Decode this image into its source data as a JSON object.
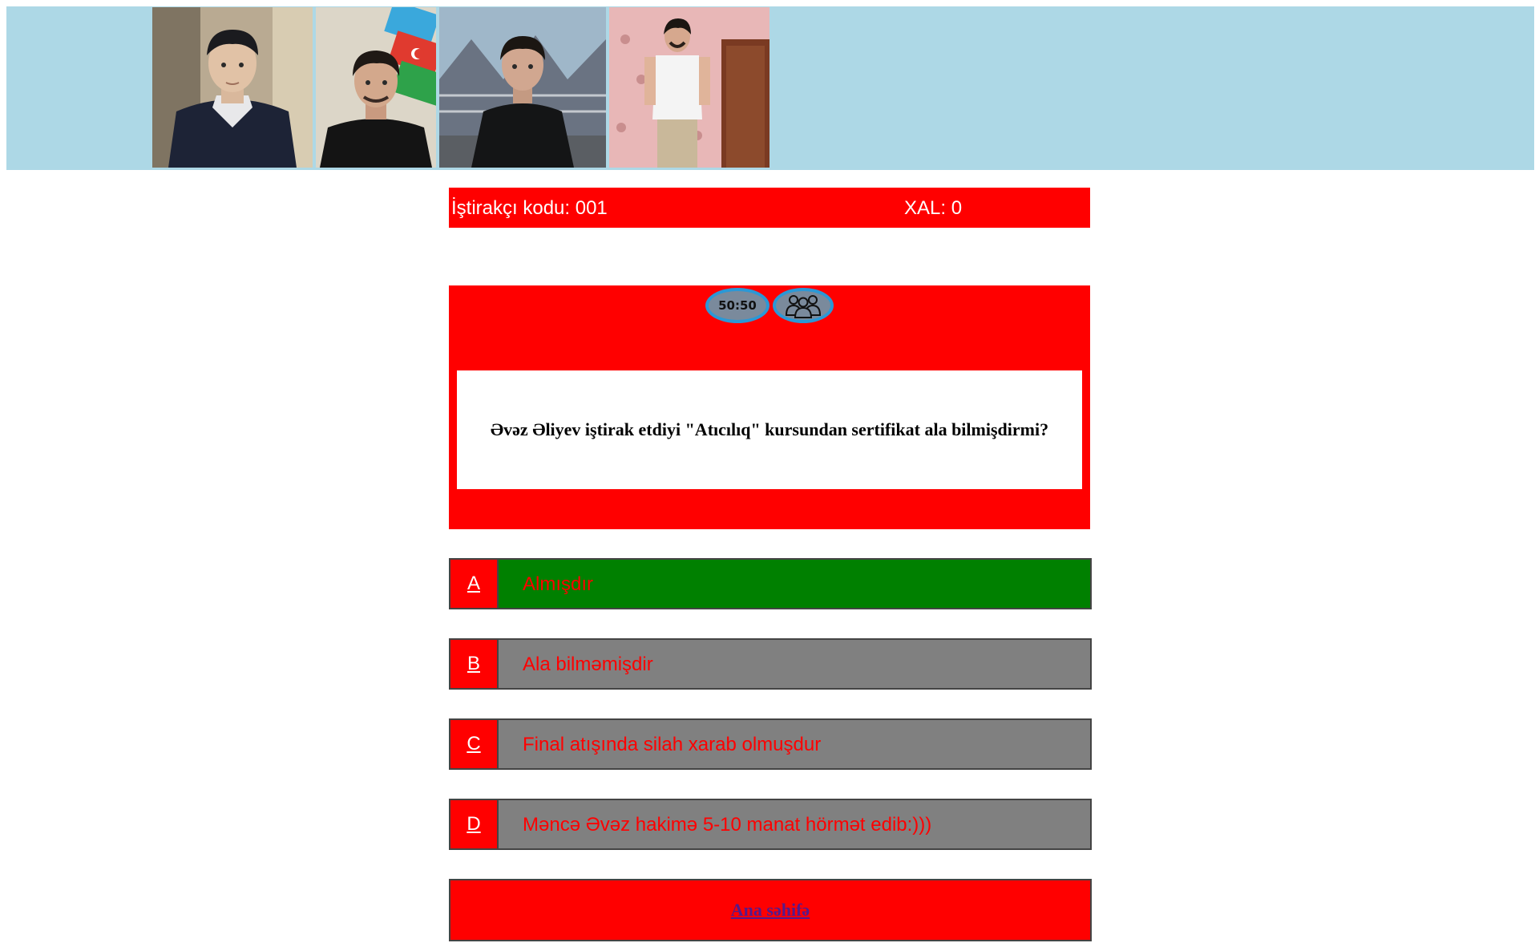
{
  "banner": {
    "photos": [
      "photo-boy-portrait",
      "photo-man-with-flag",
      "photo-man-outdoors",
      "photo-man-standing-room"
    ]
  },
  "info": {
    "participant_code": "İştirakçı kodu: 001",
    "score": "XAL: 0"
  },
  "lifelines": {
    "fifty_fifty": "50:50",
    "audience_icon": "audience-people-icon"
  },
  "question": {
    "text": "Əvəz Əliyev iştirak etdiyi \"Atıcılıq\" kursundan sertifikat ala bilmişdirmi?"
  },
  "answers": [
    {
      "letter": "A",
      "text": "Almışdır",
      "state": "correct"
    },
    {
      "letter": "B",
      "text": "Ala bilməmişdir",
      "state": "normal"
    },
    {
      "letter": "C",
      "text": "Final atışında silah xarab olmuşdur",
      "state": "normal"
    },
    {
      "letter": "D",
      "text": "Məncə Əvəz hakimə 5-10 manat hörmət edib:)))",
      "state": "normal"
    }
  ],
  "footer": {
    "home_link": "Ana səhifə"
  },
  "colors": {
    "banner_bg": "#add8e6",
    "panel_red": "#ff0000",
    "correct_green": "#008000",
    "answer_gray": "#808080",
    "lifeline_blue": "#2b98d6"
  }
}
